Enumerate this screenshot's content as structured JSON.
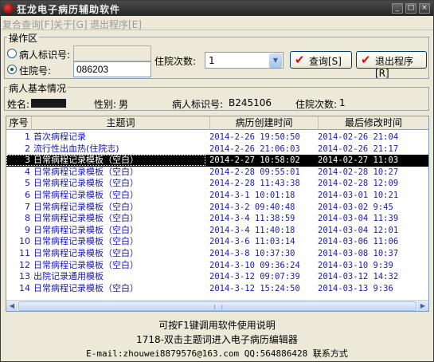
{
  "window": {
    "title": "狂龙电子病历辅助软件",
    "minimize": "_",
    "maximize": "□",
    "close": "×"
  },
  "menu": {
    "items": [
      "复合查询[F]",
      "关于[G]",
      "退出程序[E]"
    ]
  },
  "operation": {
    "group_label": "操作区",
    "patient_id_label": "病人标识号:",
    "patient_id_value": "",
    "admission_no_label": "住院号:",
    "admission_no_value": "086203",
    "admission_count_label": "住院次数:",
    "admission_count_value": "1",
    "selected_radio": "admission_no",
    "query_button": "查询[S]",
    "exit_button": "退出程序[R]"
  },
  "patient": {
    "group_label": "病人基本情况",
    "name_label": "姓名:",
    "name_value": "",
    "gender_label": "性别:",
    "gender_value": "男",
    "id_label": "病人标识号:",
    "id_value": "B245106",
    "count_label": "住院次数:",
    "count_value": "1"
  },
  "table": {
    "columns": [
      "序号",
      "主题词",
      "病历创建时间",
      "最后修改时间"
    ],
    "selected_index": 2,
    "rows": [
      {
        "no": "1",
        "subject": "首次病程记录",
        "created": "2014-2-26 19:50:50",
        "modified": "2014-02-26 21:04"
      },
      {
        "no": "2",
        "subject": "流行性出血热(住院志)",
        "created": "2014-2-26 21:06:03",
        "modified": "2014-02-26 21:17"
      },
      {
        "no": "3",
        "subject": "日常病程记录模板（空白）",
        "created": "2014-2-27 10:58:02",
        "modified": "2014-02-27 11:03"
      },
      {
        "no": "4",
        "subject": "日常病程记录模板（空白）",
        "created": "2014-2-28 09:55:01",
        "modified": "2014-02-28 10:27"
      },
      {
        "no": "5",
        "subject": "日常病程记录模板（空白）",
        "created": "2014-2-28 11:43:38",
        "modified": "2014-02-28 12:09"
      },
      {
        "no": "6",
        "subject": "日常病程记录模板（空白）",
        "created": "2014-3-1 10:01:18",
        "modified": "2014-03-01 10:21"
      },
      {
        "no": "7",
        "subject": "日常病程记录模板（空白）",
        "created": "2014-3-2 09:40:48",
        "modified": "2014-03-02 9:45"
      },
      {
        "no": "8",
        "subject": "日常病程记录模板（空白）",
        "created": "2014-3-4 11:38:59",
        "modified": "2014-03-04 11:39"
      },
      {
        "no": "9",
        "subject": "日常病程记录模板（空白）",
        "created": "2014-3-4 11:40:18",
        "modified": "2014-03-04 12:01"
      },
      {
        "no": "10",
        "subject": "日常病程记录模板（空白）",
        "created": "2014-3-6 11:03:14",
        "modified": "2014-03-06 11:06"
      },
      {
        "no": "11",
        "subject": "日常病程记录模板（空白）",
        "created": "2014-3-8 10:37:30",
        "modified": "2014-03-08 10:37"
      },
      {
        "no": "12",
        "subject": "日常病程记录模板（空白）",
        "created": "2014-3-10 09:36:24",
        "modified": "2014-03-10 9:39"
      },
      {
        "no": "13",
        "subject": "出院记录通用模板",
        "created": "2014-3-12 09:07:39",
        "modified": "2014-03-12 14:32"
      },
      {
        "no": "14",
        "subject": "日常病程记录模板（空白）",
        "created": "2014-3-12 15:24:50",
        "modified": "2014-03-13 9:36"
      }
    ]
  },
  "footer": {
    "line1": "可按F1键调用软件使用说明",
    "line2": "1718-双击主题词进入电子病历编辑器",
    "line3": "E-mail:zhouwei8879576@163.com QQ:564886428 联系方式"
  }
}
